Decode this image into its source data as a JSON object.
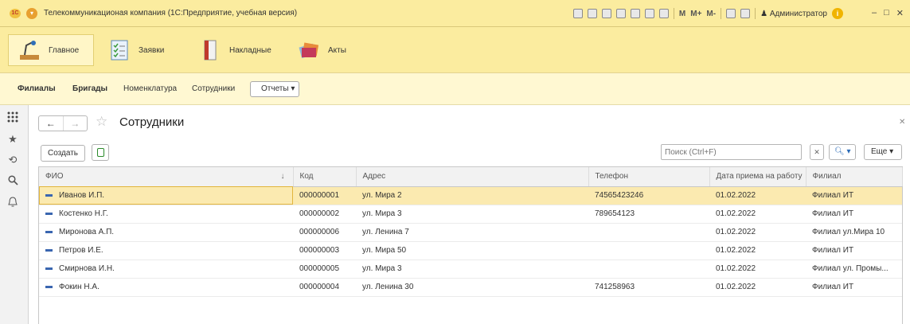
{
  "titlebar": {
    "title": "Телекоммуникационая компания (1С:Предприятие, учебная версия)",
    "logo": "1С",
    "tools": [
      "M",
      "M+",
      "M-"
    ],
    "user": "Администратор",
    "win": [
      "‒",
      "□",
      "✕"
    ]
  },
  "sections": [
    {
      "label": "Главное",
      "icon": "desk-lamp-icon"
    },
    {
      "label": "Заявки",
      "icon": "checklist-icon"
    },
    {
      "label": "Накладные",
      "icon": "binder-icon"
    },
    {
      "label": "Акты",
      "icon": "documents-icon"
    }
  ],
  "nav": {
    "items": [
      "Филиалы",
      "Бригады",
      "Номенклатура",
      "Сотрудники"
    ],
    "reports": "Отчеты ▾"
  },
  "form": {
    "title": "Сотрудники",
    "create": "Создать",
    "search_placeholder": "Поиск (Ctrl+F)",
    "search_btn": "🔍︎ ▾",
    "more": "Еще ▾"
  },
  "table": {
    "columns": [
      "ФИО",
      "Код",
      "Адрес",
      "Телефон",
      "Дата приема на работу",
      "Филиал"
    ],
    "sort_mark": "↓",
    "rows": [
      [
        "Иванов И.П.",
        "000000001",
        "ул. Мира 2",
        "74565423246",
        "01.02.2022",
        "Филиал ИТ"
      ],
      [
        "Костенко Н.Г.",
        "000000002",
        "ул. Мира 3",
        "789654123",
        "01.02.2022",
        "Филиал ИТ"
      ],
      [
        "Миронова А.П.",
        "000000006",
        "ул. Ленина 7",
        "",
        "01.02.2022",
        "Филиал ул.Мира 10"
      ],
      [
        "Петров И.Е.",
        "000000003",
        "ул. Мира 50",
        "",
        "01.02.2022",
        "Филиал ИТ"
      ],
      [
        "Смирнова И.Н.",
        "000000005",
        "ул. Мира 3",
        "",
        "01.02.2022",
        "Филиал ул. Промы..."
      ],
      [
        "Фокин Н.А.",
        "000000004",
        "ул. Ленина 30",
        "741258963",
        "01.02.2022",
        "Филиал ИТ"
      ]
    ]
  },
  "colors": {
    "panel": "#fbec9f",
    "selected_row": "#fbeab0",
    "accent": "#3a66b0"
  }
}
